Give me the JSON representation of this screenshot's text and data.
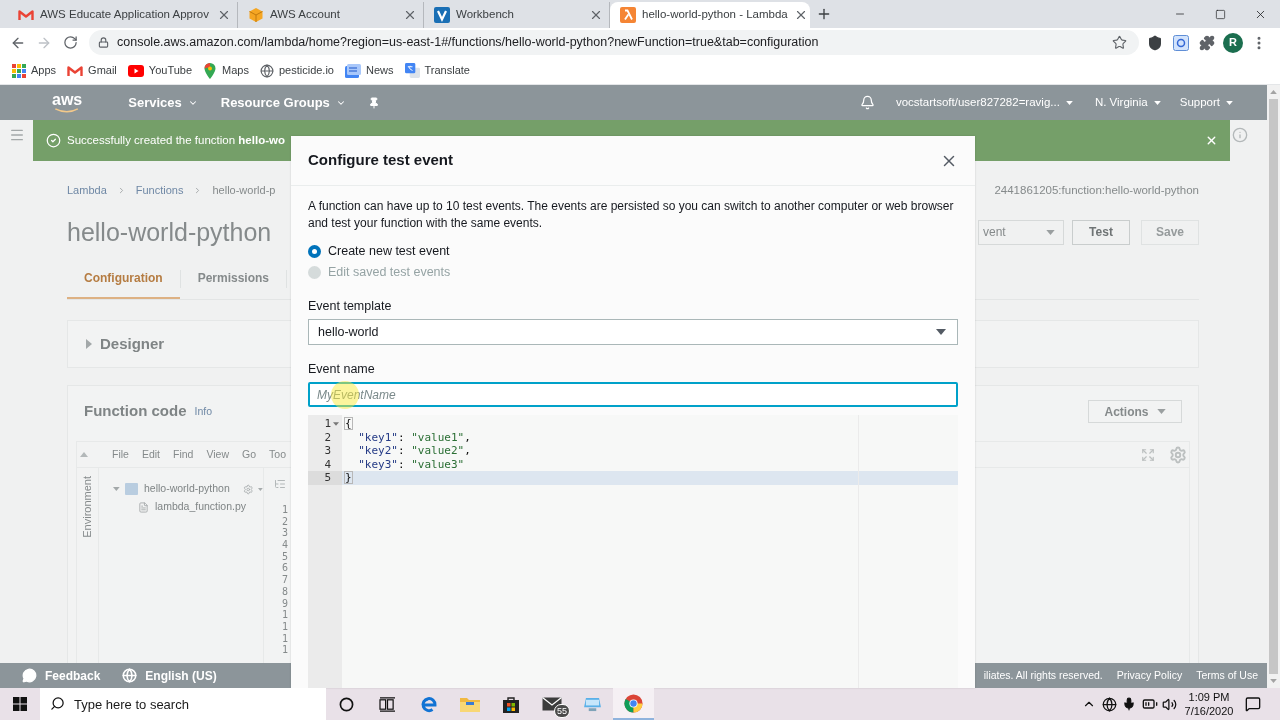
{
  "browser": {
    "tabs": [
      {
        "title": "AWS Educate Application Approv",
        "kind": "gmail",
        "selected": false
      },
      {
        "title": "AWS Account",
        "kind": "aws-box",
        "selected": false
      },
      {
        "title": "Workbench",
        "kind": "workbench",
        "selected": false
      },
      {
        "title": "hello-world-python - Lambda",
        "kind": "lambda",
        "selected": true
      }
    ],
    "url": "console.aws.amazon.com/lambda/home?region=us-east-1#/functions/hello-world-python?newFunction=true&tab=configuration",
    "profile_initial": "R",
    "bookmarks": [
      {
        "label": "Apps",
        "kind": "apps"
      },
      {
        "label": "Gmail",
        "kind": "gmail"
      },
      {
        "label": "YouTube",
        "kind": "youtube"
      },
      {
        "label": "Maps",
        "kind": "maps"
      },
      {
        "label": "pesticide.io",
        "kind": "globe"
      },
      {
        "label": "News",
        "kind": "news"
      },
      {
        "label": "Translate",
        "kind": "translate"
      }
    ]
  },
  "console": {
    "logo": "aws",
    "nav_menus": [
      "Services",
      "Resource Groups"
    ],
    "account": "vocstartsoft/user827282=ravig...",
    "region": "N. Virginia",
    "support": "Support",
    "banner": "Successfully created the function **hello-wo**",
    "breadcrumb": [
      "Lambda",
      "Functions",
      "hello-world-p"
    ],
    "arn": "2441861205:function:hello-world-python",
    "title": "hello-world-python",
    "test_event_select": "vent",
    "test_button": {
      "label": "Test",
      "disabled": false
    },
    "save_button": {
      "label": "Save",
      "disabled": true
    },
    "tabs": [
      {
        "label": "Configuration",
        "selected": true
      },
      {
        "label": "Permissions",
        "selected": false
      }
    ],
    "designer": {
      "title": "Designer",
      "expanded": false
    },
    "function_code": {
      "title": "Function code",
      "info": "Info",
      "actions": "Actions",
      "menu": [
        "File",
        "Edit",
        "Find",
        "View",
        "Go",
        "Too"
      ],
      "environment": "Environment",
      "tree": [
        {
          "name": "hello-world-python",
          "kind": "folder",
          "expanded": true,
          "children": [
            {
              "name": "lambda_function.py",
              "kind": "file"
            }
          ]
        }
      ],
      "line_numbers": [
        "1",
        "2",
        "3",
        "4",
        "5",
        "6",
        "7",
        "8",
        "9",
        "1",
        "1",
        "1",
        "1"
      ]
    },
    "footer": {
      "feedback": "Feedback",
      "language": "English (US)",
      "copyright": "iliates. All rights reserved.",
      "privacy": "Privacy Policy",
      "terms": "Terms of Use"
    }
  },
  "modal": {
    "title": "Configure test event",
    "description": "A function can have up to 10 test events. The events are persisted so you can switch to another computer or web browser and test your function with the same events.",
    "options": [
      {
        "label": "Create new test event",
        "selected": true,
        "disabled": false
      },
      {
        "label": "Edit saved test events",
        "selected": false,
        "disabled": true
      }
    ],
    "template_label": "Event template",
    "template_value": "hello-world",
    "name_label": "Event name",
    "name_placeholder": "MyEventName",
    "code_lines": [
      {
        "number": "1",
        "foldable": true,
        "active": false,
        "indented": false,
        "tokens": [
          {
            "text": "{",
            "kind": "bracket"
          }
        ]
      },
      {
        "number": "2",
        "foldable": false,
        "active": false,
        "indented": true,
        "tokens": [
          {
            "text": "\"key1\"",
            "kind": "key"
          },
          {
            "text": ":",
            "kind": "colon"
          },
          {
            "text": "\"value1\"",
            "kind": "string"
          },
          {
            "text": ",",
            "kind": "comma"
          }
        ]
      },
      {
        "number": "3",
        "foldable": false,
        "active": false,
        "indented": true,
        "tokens": [
          {
            "text": "\"key2\"",
            "kind": "key"
          },
          {
            "text": ":",
            "kind": "colon"
          },
          {
            "text": "\"value2\"",
            "kind": "string"
          },
          {
            "text": ",",
            "kind": "comma"
          }
        ]
      },
      {
        "number": "4",
        "foldable": false,
        "active": false,
        "indented": true,
        "tokens": [
          {
            "text": "\"key3\"",
            "kind": "key"
          },
          {
            "text": ":",
            "kind": "colon"
          },
          {
            "text": "\"value3\"",
            "kind": "string"
          }
        ]
      },
      {
        "number": "5",
        "foldable": false,
        "active": true,
        "indented": false,
        "tokens": [
          {
            "text": "}",
            "kind": "bracket"
          }
        ]
      }
    ]
  },
  "taskbar": {
    "search_placeholder": "Type here to search",
    "apps": [
      {
        "kind": "cortana",
        "active": false
      },
      {
        "kind": "task-view",
        "active": false
      },
      {
        "kind": "edge",
        "active": false
      },
      {
        "kind": "explorer",
        "active": false
      },
      {
        "kind": "store",
        "active": false
      },
      {
        "kind": "mail",
        "active": false,
        "badge": "55"
      },
      {
        "kind": "app",
        "active": false
      },
      {
        "kind": "chrome",
        "active": true
      }
    ],
    "time": "1:09 PM",
    "date": "7/16/2020"
  }
}
